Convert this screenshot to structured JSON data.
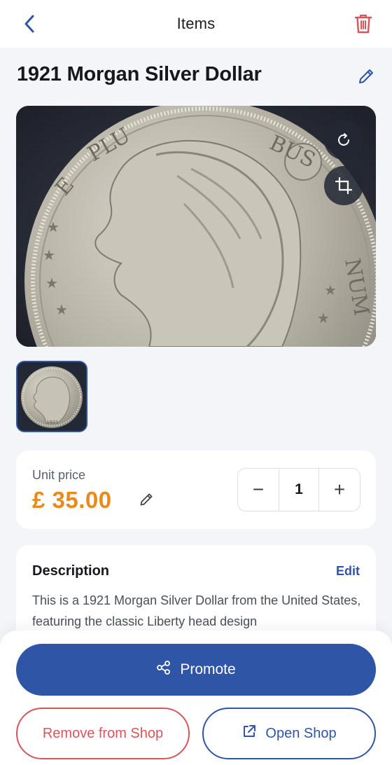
{
  "header": {
    "title": "Items",
    "back_icon": "chevron-left-icon",
    "delete_icon": "trash-icon",
    "accent_color": "#2f56a6",
    "danger_color": "#d9545b"
  },
  "item": {
    "title": "1921 Morgan Silver Dollar",
    "edit_icon": "pencil-icon",
    "image_alt": "1921 Morgan Silver Dollar coin, Liberty head",
    "coin_legend": "E·PLURIBUS·UNUM",
    "thumb_date": "1921"
  },
  "image_controls": {
    "rotate_icon": "rotate-icon",
    "crop_icon": "crop-icon"
  },
  "price": {
    "label": "Unit price",
    "value": "£ 35.00",
    "value_color": "#ea8a1b",
    "edit_icon": "pencil-icon"
  },
  "quantity": {
    "decrement": "−",
    "value": "1",
    "increment": "+"
  },
  "description": {
    "heading": "Description",
    "edit_label": "Edit",
    "text": "This is a 1921 Morgan Silver Dollar from the United States, featuring the classic Liberty head design"
  },
  "actions": {
    "promote_label": "Promote",
    "promote_icon": "share-icon",
    "remove_label": "Remove from Shop",
    "open_label": "Open Shop",
    "open_icon": "external-link-icon"
  }
}
